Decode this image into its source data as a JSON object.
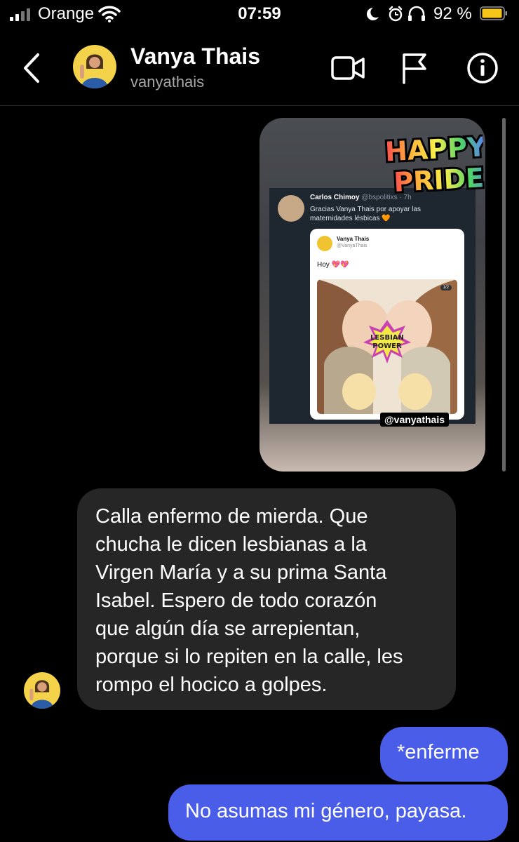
{
  "status_bar": {
    "carrier": "Orange",
    "time": "07:59",
    "battery_percent": "92 %",
    "icons": [
      "signal-icon",
      "wifi-icon",
      "moon-icon",
      "alarm-icon",
      "headphones-icon",
      "battery-icon"
    ]
  },
  "header": {
    "name": "Vanya Thais",
    "username": "vanyathais",
    "icons": [
      "back-chevron-icon",
      "video-call-icon",
      "flag-icon",
      "info-icon"
    ]
  },
  "story_reply": {
    "sticker_line1": "HAPPY",
    "sticker_line2": "PRIDE!",
    "tweet_author": "Carlos Chimoy",
    "tweet_meta": "@bspolitixs · 7h",
    "tweet_text": "Gracias Vanya Thais por apoyar las maternidades lésbicas 🧡",
    "quoted_name": "Vanya Thais",
    "quoted_handle": "@VanyaThais",
    "quoted_text": "Hoy 💖💖",
    "image_text1": "LESBIAN",
    "image_text2": "POWER",
    "page_indicator": "1/2",
    "watermark": "@vanyathais"
  },
  "messages": [
    {
      "direction": "received",
      "text": "Calla enfermo de mierda. Que\nchucha le dicen lesbianas a la\nVirgen María y a su prima Santa\nIsabel. Espero de todo corazón\nque algún día se arrepientan,\nporque si lo repiten en la calle, les\nrompo el hocico a golpes."
    },
    {
      "direction": "sent",
      "text": "*enferme"
    },
    {
      "direction": "sent",
      "text": "No asumas mi género, payasa."
    }
  ],
  "colors": {
    "background": "#000000",
    "received_bubble": "#262626",
    "sent_bubble": "#4a5de8",
    "battery": "#f5c518"
  }
}
